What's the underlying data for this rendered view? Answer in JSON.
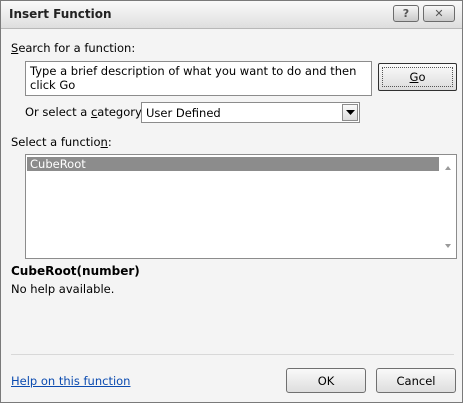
{
  "window": {
    "title": "Insert Function",
    "help_glyph": "?",
    "close_glyph": "✕"
  },
  "search": {
    "label_pre": "",
    "label_accel": "S",
    "label_post": "earch for a function:",
    "value": "Type a brief description of what you want to do and then click Go",
    "go_accel": "G",
    "go_post": "o"
  },
  "category": {
    "label_pre": "Or select a ",
    "label_accel": "c",
    "label_post": "ategory:",
    "selected": "User Defined"
  },
  "functions": {
    "label_pre": "Select a functio",
    "label_accel": "n",
    "label_post": ":",
    "items": [
      "CubeRoot"
    ],
    "selected_index": 0
  },
  "details": {
    "signature": "CubeRoot(number)",
    "description": "No help available."
  },
  "footer": {
    "help_link": "Help on this function",
    "ok_label": "OK",
    "cancel_label": "Cancel"
  },
  "colors": {
    "selection": "#8c8c8c",
    "link": "#0b4bb0"
  }
}
